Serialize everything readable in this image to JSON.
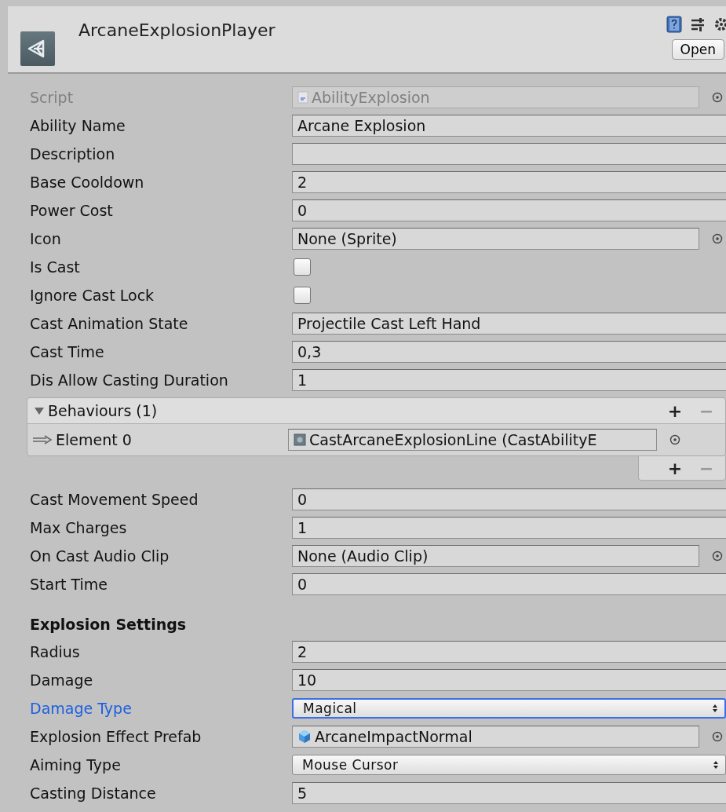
{
  "header": {
    "title": "ArcaneExplosionPlayer",
    "open_button": "Open"
  },
  "fields_top": [
    {
      "label": "Script",
      "kind": "script",
      "value": "AbilityExplosion",
      "disabled": true
    },
    {
      "label": "Ability Name",
      "kind": "text",
      "value": "Arcane Explosion"
    },
    {
      "label": "Description",
      "kind": "text"
    },
    {
      "label": "Base Cooldown",
      "kind": "text",
      "value": "2"
    },
    {
      "label": "Power Cost",
      "kind": "text",
      "value": "0"
    },
    {
      "label": "Icon",
      "kind": "object",
      "value": "None (Sprite)"
    },
    {
      "label": "Is Cast",
      "kind": "checkbox",
      "checked": false
    },
    {
      "label": "Ignore Cast Lock",
      "kind": "checkbox",
      "checked": false
    },
    {
      "label": "Cast Animation State",
      "kind": "text",
      "value": "Projectile Cast Left Hand"
    },
    {
      "label": "Cast Time",
      "kind": "text",
      "value": "0,3"
    },
    {
      "label": "Dis Allow Casting Duration",
      "kind": "text",
      "value": "1"
    }
  ],
  "list": {
    "title": "Behaviours (1)",
    "expanded": true,
    "add": "+",
    "remove": "−",
    "elements": [
      {
        "label": "Element 0",
        "value": "CastArcaneExplosionLine (CastAbilityE"
      }
    ]
  },
  "fields_mid": [
    {
      "label": "Cast Movement Speed",
      "kind": "text",
      "value": "0"
    },
    {
      "label": "Max Charges",
      "kind": "text",
      "value": "1"
    },
    {
      "label": "On Cast Audio Clip",
      "kind": "object",
      "value": "None (Audio Clip)"
    },
    {
      "label": "Start Time",
      "kind": "text",
      "value": "0"
    }
  ],
  "section": {
    "title": "Explosion Settings",
    "fields": [
      {
        "label": "Radius",
        "kind": "text",
        "value": "2"
      },
      {
        "label": "Damage",
        "kind": "text",
        "value": "10"
      },
      {
        "label": "Damage Type",
        "kind": "dropdown",
        "value": "Magical",
        "focused": true
      },
      {
        "label": "Explosion Effect Prefab",
        "kind": "prefab",
        "value": "ArcaneImpactNormal"
      },
      {
        "label": "Aiming Type",
        "kind": "dropdown",
        "value": "Mouse Cursor",
        "focused": false
      },
      {
        "label": "Casting Distance",
        "kind": "text",
        "value": "5"
      }
    ]
  }
}
